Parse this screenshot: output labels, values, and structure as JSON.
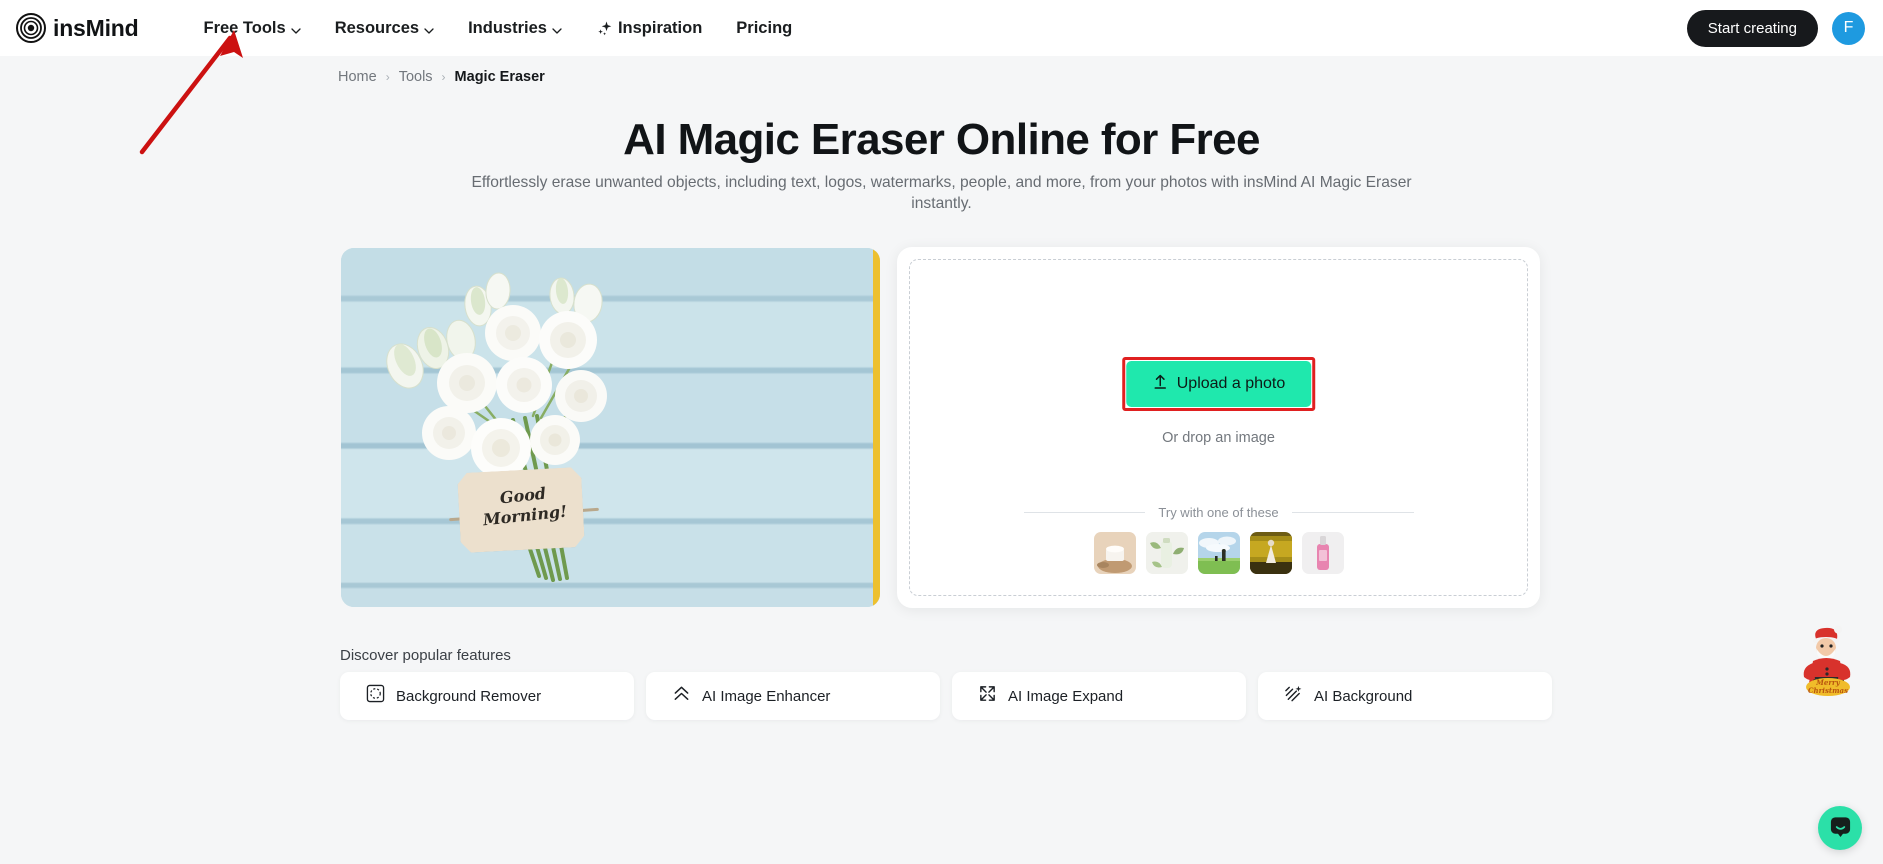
{
  "header": {
    "logo_text": "insMind",
    "logo_icon": "concentric-circles-logo",
    "nav": [
      {
        "label": "Free Tools",
        "has_caret": true,
        "icon": ""
      },
      {
        "label": "Resources",
        "has_caret": true,
        "icon": ""
      },
      {
        "label": "Industries",
        "has_caret": true,
        "icon": ""
      },
      {
        "label": "Inspiration",
        "has_caret": false,
        "icon": "sparkle-icon"
      },
      {
        "label": "Pricing",
        "has_caret": false,
        "icon": ""
      }
    ],
    "cta_label": "Start creating",
    "avatar_initial": "F"
  },
  "breadcrumb": {
    "items": [
      "Home",
      "Tools"
    ],
    "separator": "›",
    "current": "Magic Eraser"
  },
  "hero": {
    "title": "AI Magic Eraser Online for Free",
    "subtitle": "Effortlessly erase unwanted objects, including text, logos, watermarks, people, and more, from your photos with insMind AI Magic Eraser instantly."
  },
  "demo": {
    "alt": "White flower bouquet on light blue wooden planks",
    "tag_line1": "Good",
    "tag_line2": "Morning!",
    "edge_color": "#edc02f"
  },
  "upload": {
    "button_label": "Upload a photo",
    "upload_icon": "upload-arrow-icon",
    "drop_hint": "Or drop an image",
    "try_label": "Try with one of these",
    "highlight_color": "#e02020",
    "button_color": "#1fe8ad",
    "samples": [
      {
        "name": "sample-cosmetic-jar",
        "c1": "#e5cdb4",
        "c2": "#c9a07a"
      },
      {
        "name": "sample-skincare-tube",
        "c1": "#eef0e8",
        "c2": "#b9c9a6"
      },
      {
        "name": "sample-field-couple",
        "c1": "#bcd8ea",
        "c2": "#87c05a"
      },
      {
        "name": "sample-rapeseed-girl",
        "c1": "#7d6a18",
        "c2": "#2e2a10"
      },
      {
        "name": "sample-pink-bottle",
        "c1": "#efeff0",
        "c2": "#e88fb4"
      }
    ]
  },
  "features": {
    "title": "Discover popular features",
    "items": [
      {
        "label": "Background Remover",
        "icon": "background-remover-icon"
      },
      {
        "label": "AI Image Enhancer",
        "icon": "double-chevron-up-icon"
      },
      {
        "label": "AI Image Expand",
        "icon": "expand-arrows-icon"
      },
      {
        "label": "AI Background",
        "icon": "diagonal-stripes-sparkle-icon"
      }
    ]
  },
  "floating": {
    "santa_label": "Merry Christmas",
    "santa_icon": "santa-claus-icon",
    "chat_icon": "chat-bubble-icon",
    "chat_color": "#2be0a8"
  },
  "annotation": {
    "arrow_color": "#cc1111",
    "points_to": "Free Tools"
  }
}
